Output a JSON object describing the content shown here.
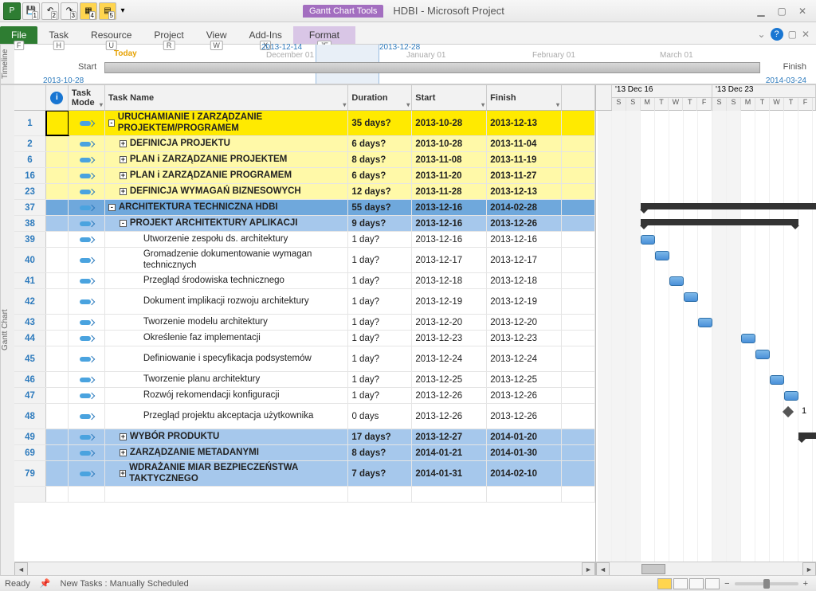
{
  "app": {
    "title": "HDBI - Microsoft Project",
    "tools_tab": "Gantt Chart Tools"
  },
  "ribbon": {
    "file": "File",
    "file_key": "F",
    "tabs": [
      {
        "label": "Task",
        "key": "H"
      },
      {
        "label": "Resource",
        "key": "U"
      },
      {
        "label": "Project",
        "key": "R"
      },
      {
        "label": "View",
        "key": "W"
      },
      {
        "label": "Add-Ins",
        "key": "X"
      }
    ],
    "format": "Format",
    "format_key": "JF"
  },
  "timeline": {
    "label": "Timeline",
    "today": "Today",
    "start": "Start",
    "start_date": "2013-10-28",
    "finish": "Finish",
    "finish_date": "2014-03-24",
    "marks": [
      {
        "label": "2013-12-14",
        "sub": "December 01"
      },
      {
        "label": "2013-12-28",
        "sub": "January 01"
      }
    ],
    "months": [
      "February 01",
      "March 01"
    ]
  },
  "columns": {
    "info": "ⓘ",
    "mode": "Task Mode",
    "name": "Task Name",
    "duration": "Duration",
    "start": "Start",
    "finish": "Finish"
  },
  "weeks": [
    {
      "title": "'13 Dec 16",
      "days": [
        "S",
        "S",
        "M",
        "T",
        "W",
        "T",
        "F"
      ]
    },
    {
      "title": "'13 Dec 23",
      "days": [
        "S",
        "S",
        "M",
        "T",
        "W",
        "T",
        "F"
      ]
    }
  ],
  "rows": [
    {
      "id": "1",
      "cls": "yellow tall bold",
      "exp": "-",
      "indent": 0,
      "name": "URUCHAMIANIE I ZARZĄDZANIE PROJEKTEM/PROGRAMEM",
      "dur": "35 days?",
      "start": "2013-10-28",
      "finish": "2013-12-13"
    },
    {
      "id": "2",
      "cls": "lightyellow bold",
      "exp": "+",
      "indent": 1,
      "name": "DEFINICJA PROJEKTU",
      "dur": "6 days?",
      "start": "2013-10-28",
      "finish": "2013-11-04"
    },
    {
      "id": "6",
      "cls": "lightyellow bold",
      "exp": "+",
      "indent": 1,
      "name": "PLAN i ZARZĄDZANIE PROJEKTEM",
      "dur": "8 days?",
      "start": "2013-11-08",
      "finish": "2013-11-19"
    },
    {
      "id": "16",
      "cls": "lightyellow bold",
      "exp": "+",
      "indent": 1,
      "name": "PLAN i ZARZĄDZANIE PROGRAMEM",
      "dur": "6 days?",
      "start": "2013-11-20",
      "finish": "2013-11-27"
    },
    {
      "id": "23",
      "cls": "lightyellow bold",
      "exp": "+",
      "indent": 1,
      "name": "DEFINICJA WYMAGAŃ BIZNESOWYCH",
      "dur": "12 days?",
      "start": "2013-11-28",
      "finish": "2013-12-13"
    },
    {
      "id": "37",
      "cls": "blue bold",
      "exp": "-",
      "indent": 0,
      "name": "ARCHITEKTURA TECHNICZNA HDBI",
      "dur": "55 days?",
      "start": "2013-12-16",
      "finish": "2014-02-28"
    },
    {
      "id": "38",
      "cls": "lightblue bold",
      "exp": "-",
      "indent": 1,
      "name": "PROJEKT ARCHITEKTURY APLIKACJI",
      "dur": "9 days?",
      "start": "2013-12-16",
      "finish": "2013-12-26"
    },
    {
      "id": "39",
      "cls": "",
      "indent": 3,
      "name": "Utworzenie zespołu ds. architektury",
      "dur": "1 day?",
      "start": "2013-12-16",
      "finish": "2013-12-16"
    },
    {
      "id": "40",
      "cls": "tall",
      "indent": 3,
      "name": "Gromadzenie dokumentowanie wymagan technicznych",
      "dur": "1 day?",
      "start": "2013-12-17",
      "finish": "2013-12-17"
    },
    {
      "id": "41",
      "cls": "",
      "indent": 3,
      "name": "Przegląd środowiska technicznego",
      "dur": "1 day?",
      "start": "2013-12-18",
      "finish": "2013-12-18"
    },
    {
      "id": "42",
      "cls": "tall",
      "indent": 3,
      "name": "Dokument implikacji rozwoju architektury",
      "dur": "1 day?",
      "start": "2013-12-19",
      "finish": "2013-12-19"
    },
    {
      "id": "43",
      "cls": "",
      "indent": 3,
      "name": "Tworzenie modelu architektury",
      "dur": "1 day?",
      "start": "2013-12-20",
      "finish": "2013-12-20"
    },
    {
      "id": "44",
      "cls": "",
      "indent": 3,
      "name": "Określenie faz implementacji",
      "dur": "1 day?",
      "start": "2013-12-23",
      "finish": "2013-12-23"
    },
    {
      "id": "45",
      "cls": "tall",
      "indent": 3,
      "name": "Definiowanie i specyfikacja podsystemów",
      "dur": "1 day?",
      "start": "2013-12-24",
      "finish": "2013-12-24"
    },
    {
      "id": "46",
      "cls": "",
      "indent": 3,
      "name": "Tworzenie planu architektury",
      "dur": "1 day?",
      "start": "2013-12-25",
      "finish": "2013-12-25"
    },
    {
      "id": "47",
      "cls": "",
      "indent": 3,
      "name": "Rozwój rekomendacji konfiguracji",
      "dur": "1 day?",
      "start": "2013-12-26",
      "finish": "2013-12-26"
    },
    {
      "id": "48",
      "cls": "tall",
      "indent": 3,
      "name": "Przegląd projektu akceptacja użytkownika",
      "dur": "0 days",
      "start": "2013-12-26",
      "finish": "2013-12-26"
    },
    {
      "id": "49",
      "cls": "lightblue bold",
      "exp": "+",
      "indent": 1,
      "name": "WYBÓR PRODUKTU",
      "dur": "17 days?",
      "start": "2013-12-27",
      "finish": "2014-01-20"
    },
    {
      "id": "69",
      "cls": "lightblue bold",
      "exp": "+",
      "indent": 1,
      "name": "ZARZĄDZANIE METADANYMI",
      "dur": "8 days?",
      "start": "2014-01-21",
      "finish": "2014-01-30"
    },
    {
      "id": "79",
      "cls": "lightblue bold tall",
      "exp": "+",
      "indent": 1,
      "name": "WDRAŻANIE MIAR BEZPIECZEŃSTWA TAKTYCZNEGO",
      "dur": "7 days?",
      "start": "2014-01-31",
      "finish": "2014-02-10"
    }
  ],
  "status": {
    "ready": "Ready",
    "newtasks": "New Tasks : Manually Scheduled"
  },
  "left_label": "Gantt Chart",
  "milestone_label": "1"
}
